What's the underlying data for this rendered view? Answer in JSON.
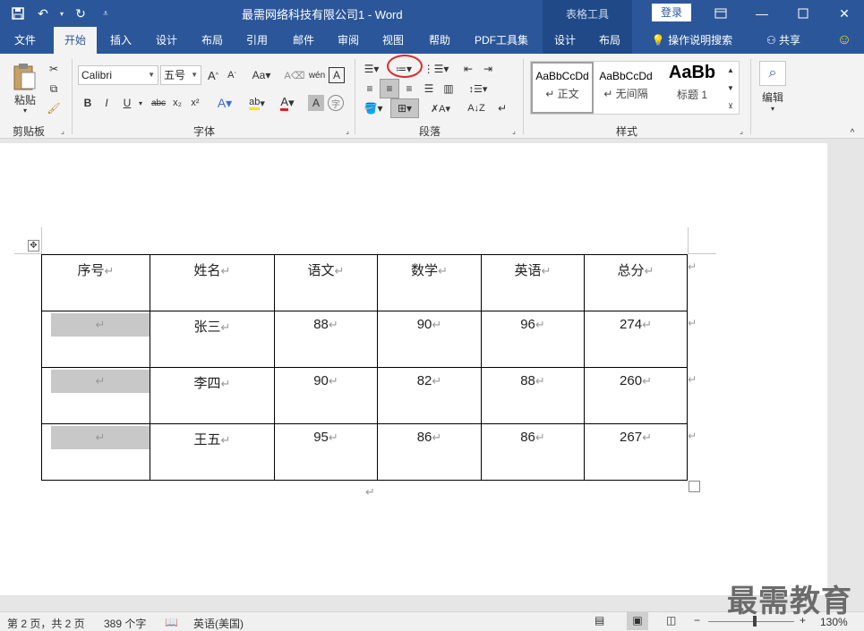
{
  "titlebar": {
    "title": "最需网络科技有限公司1  -  Word",
    "context_tab": "表格工具",
    "login": "登录",
    "save_icon": "save-icon",
    "undo_icon": "undo-icon",
    "redo_icon": "redo-icon"
  },
  "tabs": [
    {
      "label": "文件"
    },
    {
      "label": "开始"
    },
    {
      "label": "插入"
    },
    {
      "label": "设计"
    },
    {
      "label": "布局"
    },
    {
      "label": "引用"
    },
    {
      "label": "邮件"
    },
    {
      "label": "审阅"
    },
    {
      "label": "视图"
    },
    {
      "label": "帮助"
    },
    {
      "label": "PDF工具集"
    },
    {
      "label": "设计"
    },
    {
      "label": "布局"
    }
  ],
  "tell_me": "操作说明搜索",
  "share": "共享",
  "ribbon": {
    "clipboard": {
      "paste": "粘贴",
      "label": "剪贴板"
    },
    "font": {
      "name": "Calibri",
      "size": "五号",
      "label": "字体"
    },
    "paragraph": {
      "label": "段落"
    },
    "styles": {
      "label": "样式",
      "items": [
        {
          "sample": "AaBbCcDd",
          "name": "↵ 正文"
        },
        {
          "sample": "AaBbCcDd",
          "name": "↵ 无间隔"
        },
        {
          "sample": "AaBb",
          "name": "标题 1"
        }
      ]
    },
    "editing": {
      "label": "编辑"
    }
  },
  "table": {
    "headers": [
      "序号",
      "姓名",
      "语文",
      "数学",
      "英语",
      "总分"
    ],
    "rows": [
      {
        "name": "张三",
        "chinese": "88",
        "math": "90",
        "english": "96",
        "total": "274"
      },
      {
        "name": "李四",
        "chinese": "90",
        "math": "82",
        "english": "88",
        "total": "260"
      },
      {
        "name": "王五",
        "chinese": "95",
        "math": "86",
        "english": "86",
        "total": "267"
      }
    ]
  },
  "status": {
    "page": "第 2 页，共 2 页",
    "words": "389 个字",
    "language": "英语(美国)",
    "zoom": "130%"
  },
  "watermark": "最需教育"
}
